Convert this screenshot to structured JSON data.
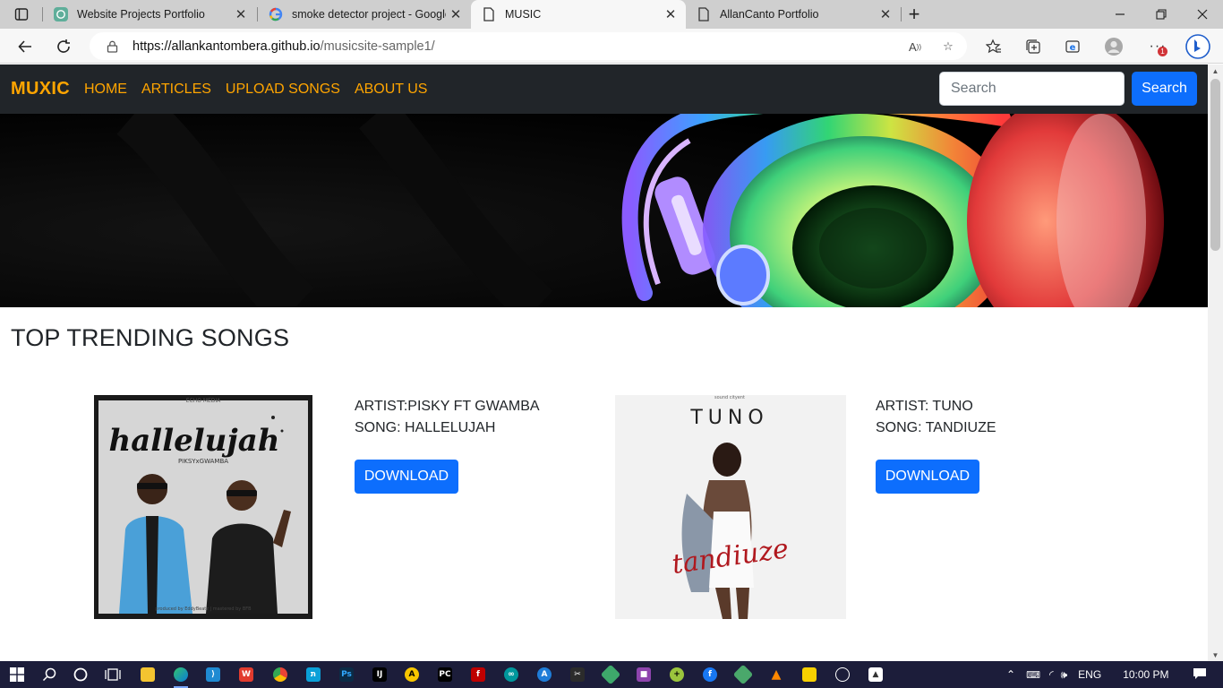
{
  "browser": {
    "tabs": [
      {
        "title": "Website Projects Portfolio",
        "icon": "chatgpt-icon"
      },
      {
        "title": "smoke detector project - Google",
        "icon": "google-icon"
      },
      {
        "title": "MUSIC",
        "icon": "page-icon"
      },
      {
        "title": "AllanCanto Portfolio",
        "icon": "page-icon"
      }
    ],
    "url_host": "https://allankantombera.github.io",
    "url_path": "/musicsite-sample1/",
    "notification_count": "1"
  },
  "site": {
    "brand": "MUXIC",
    "nav": [
      "HOME",
      "ARTICLES",
      "UPLOAD SONGS",
      "ABOUT US"
    ],
    "search_placeholder": "Search",
    "search_button": "Search",
    "section_title": "TOP TRENDING SONGS",
    "songs": [
      {
        "artist": "ARTIST:PISKY FT GWAMBA",
        "song": "SONG: HALLELUJAH",
        "download": "DOWNLOAD",
        "cover_title": "hallelujah",
        "cover_subtitle": "PIKSYxGWAMBA",
        "cover_top": "ECHO MEDIA",
        "cover_footer": "produced by EddyBeatz | mastered by BFB"
      },
      {
        "artist": "ARTIST: TUNO",
        "song": "SONG: TANDIUZE",
        "download": "DOWNLOAD",
        "cover_title": "TUNO",
        "cover_top": "sound cityent",
        "cover_script": "tandiuze"
      }
    ]
  },
  "taskbar": {
    "language": "ENG",
    "time": "10:00 PM"
  }
}
